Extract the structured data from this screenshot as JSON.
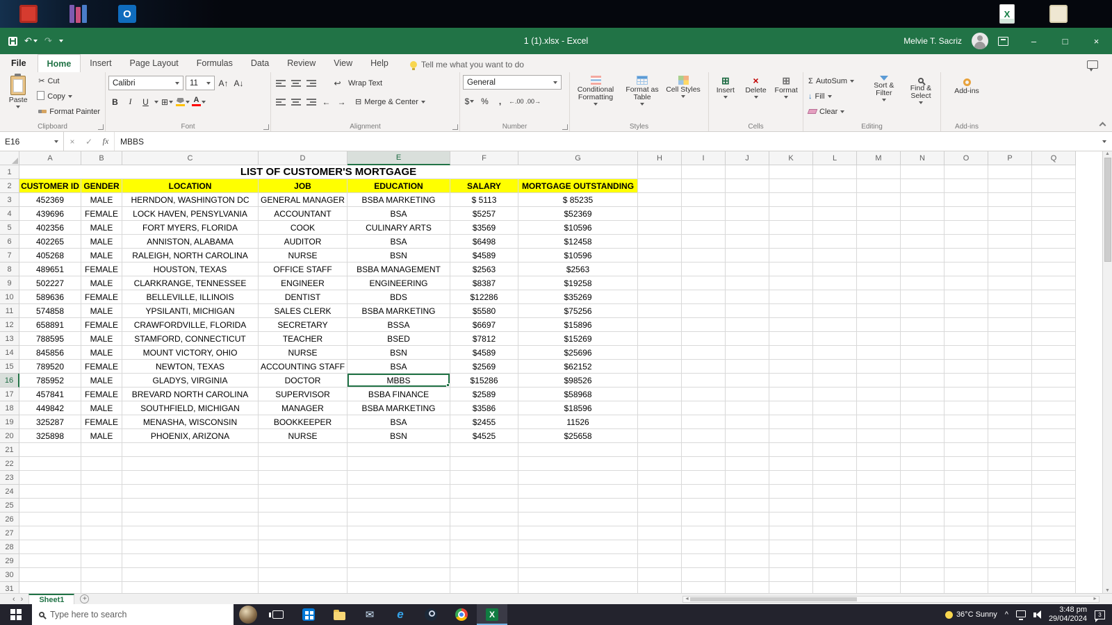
{
  "window": {
    "title": "1 (1).xlsx  -  Excel",
    "user": "Melvie T. Sacriz"
  },
  "tabs": {
    "items": [
      "File",
      "Home",
      "Insert",
      "Page Layout",
      "Formulas",
      "Data",
      "Review",
      "View",
      "Help"
    ],
    "active": "Home",
    "tell_me": "Tell me what you want to do"
  },
  "ribbon": {
    "clipboard": {
      "label": "Clipboard",
      "paste": "Paste",
      "cut": "Cut",
      "copy": "Copy",
      "format_painter": "Format Painter"
    },
    "font": {
      "label": "Font",
      "name": "Calibri",
      "size": "11"
    },
    "alignment": {
      "label": "Alignment",
      "wrap_text": "Wrap Text",
      "merge_center": "Merge & Center"
    },
    "number": {
      "label": "Number",
      "format": "General"
    },
    "styles": {
      "label": "Styles",
      "conditional": "Conditional Formatting",
      "format_table": "Format as Table",
      "cell_styles": "Cell Styles"
    },
    "cells": {
      "label": "Cells",
      "insert": "Insert",
      "delete": "Delete",
      "format": "Format"
    },
    "editing": {
      "label": "Editing",
      "autosum": "AutoSum",
      "fill": "Fill",
      "clear": "Clear",
      "sort_filter": "Sort & Filter",
      "find_select": "Find & Select"
    },
    "addins": {
      "label": "Add-ins",
      "button": "Add-ins"
    }
  },
  "formula_bar": {
    "name_box": "E16",
    "value": "MBBS"
  },
  "sheet": {
    "tab_name": "Sheet1",
    "columns": [
      "A",
      "B",
      "C",
      "D",
      "E",
      "F",
      "G",
      "H",
      "I",
      "J",
      "K",
      "L",
      "M",
      "N",
      "O",
      "P",
      "Q"
    ],
    "visible_rows": 31,
    "selected_cell": "E16",
    "title": "LIST OF CUSTOMER'S MORTGAGE",
    "headers": [
      "CUSTOMER ID",
      "GENDER",
      "LOCATION",
      "JOB",
      "EDUCATION",
      "SALARY",
      "MORTGAGE OUTSTANDING"
    ],
    "rows": [
      [
        "452369",
        "MALE",
        "HERNDON, WASHINGTON DC",
        "GENERAL MANAGER",
        "BSBA MARKETING",
        "$ 5113",
        "$ 85235"
      ],
      [
        "439696",
        "FEMALE",
        "LOCK  HAVEN, PENSYLVANIA",
        "ACCOUNTANT",
        "BSA",
        "$5257",
        "$52369"
      ],
      [
        "402356",
        "MALE",
        "FORT MYERS, FLORIDA",
        "COOK",
        "CULINARY ARTS",
        "$3569",
        "$10596"
      ],
      [
        "402265",
        "MALE",
        "ANNISTON, ALABAMA",
        "AUDITOR",
        "BSA",
        "$6498",
        "$12458"
      ],
      [
        "405268",
        "MALE",
        "RALEIGH, NORTH CAROLINA",
        "NURSE",
        "BSN",
        "$4589",
        "$10596"
      ],
      [
        "489651",
        "FEMALE",
        "HOUSTON, TEXAS",
        "OFFICE STAFF",
        "BSBA MANAGEMENT",
        "$2563",
        "$2563"
      ],
      [
        "502227",
        "MALE",
        "CLARKRANGE, TENNESSEE",
        "ENGINEER",
        "ENGINEERING",
        "$8387",
        "$19258"
      ],
      [
        "589636",
        "FEMALE",
        "BELLEVILLE, ILLINOIS",
        "DENTIST",
        "BDS",
        "$12286",
        "$35269"
      ],
      [
        "574858",
        "MALE",
        "YPSILANTI, MICHIGAN",
        "SALES CLERK",
        "BSBA MARKETING",
        "$5580",
        "$75256"
      ],
      [
        "658891",
        "FEMALE",
        "CRAWFORDVILLE, FLORIDA",
        "SECRETARY",
        "BSSA",
        "$6697",
        "$15896"
      ],
      [
        "788595",
        "MALE",
        "STAMFORD, CONNECTICUT",
        "TEACHER",
        "BSED",
        "$7812",
        "$15269"
      ],
      [
        "845856",
        "MALE",
        "MOUNT VICTORY, OHIO",
        "NURSE",
        "BSN",
        "$4589",
        "$25696"
      ],
      [
        "789520",
        "FEMALE",
        "NEWTON, TEXAS",
        "ACCOUNTING STAFF",
        "BSA",
        "$2569",
        "$62152"
      ],
      [
        "785952",
        "MALE",
        "GLADYS, VIRGINIA",
        "DOCTOR",
        "MBBS",
        "$15286",
        "$98526"
      ],
      [
        "457841",
        "FEMALE",
        "BREVARD NORTH CAROLINA",
        "SUPERVISOR",
        "BSBA FINANCE",
        "$2589",
        "$58968"
      ],
      [
        "449842",
        "MALE",
        "SOUTHFIELD, MICHIGAN",
        "MANAGER",
        "BSBA MARKETING",
        "$3586",
        "$18596"
      ],
      [
        "325287",
        "FEMALE",
        "MENASHA, WISCONSIN",
        "BOOKKEEPER",
        "BSA",
        "$2455",
        "11526"
      ],
      [
        "325898",
        "MALE",
        "PHOENIX, ARIZONA",
        "NURSE",
        "BSN",
        "$4525",
        "$25658"
      ]
    ]
  },
  "taskbar": {
    "search_placeholder": "Type here to search",
    "weather": "36°C  Sunny",
    "time": "3:48 pm",
    "date": "29/04/2024",
    "notification_count": "3"
  },
  "glyphs": {
    "undo": "↶",
    "redo": "↷",
    "minimize": "–",
    "maximize": "□",
    "close": "×",
    "cut": "✂",
    "bold": "B",
    "italic": "I",
    "underline": "U",
    "borders": "⊞",
    "grow_font": "A↑",
    "shrink_font": "A↓",
    "font_color_a": "A",
    "wrap_icon": "↩",
    "merge_icon": "⊟",
    "indent_left": "←",
    "indent_right": "→",
    "dollar": "$",
    "percent": "%",
    "comma": ",",
    "dec_inc": "←.00",
    "dec_dec": ".00→",
    "sigma": "Σ",
    "fill_arrow": "↓",
    "grid": "⊞",
    "delete_x": "×",
    "cancel": "×",
    "enter": "✓",
    "fx": "fx",
    "scroll_up": "▲",
    "scroll_down": "▼",
    "scroll_left": "◄",
    "scroll_right": "►",
    "nav_left": "‹",
    "nav_right": "›",
    "add_sheet": "+",
    "excel_letter": "X",
    "edge_letter": "e",
    "outlook_letter": "O",
    "tray_expand": "^"
  }
}
